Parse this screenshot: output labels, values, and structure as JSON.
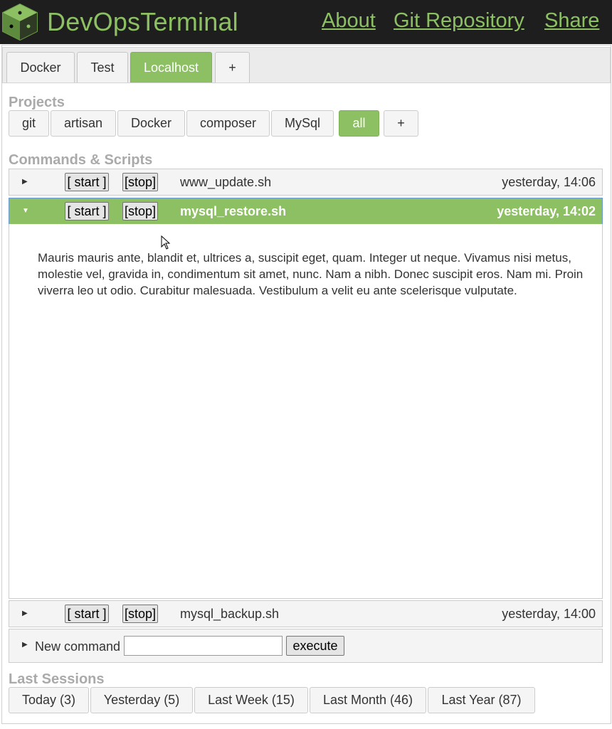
{
  "header": {
    "brand": "DevOpsTerminal",
    "links": [
      "About",
      "Git Repository",
      "Share"
    ],
    "brand_color": "#8cc063"
  },
  "env_tabs": [
    "Docker",
    "Test",
    "Localhost",
    "+"
  ],
  "active_env_tab": "Localhost",
  "projects": {
    "title": "Projects",
    "items": [
      "git",
      "artisan",
      "Docker",
      "composer",
      "MySql",
      "all",
      "+"
    ],
    "active": "all"
  },
  "commands": {
    "title": "Commands & Scripts",
    "rows": [
      {
        "start": "[ start ]",
        "stop": "[stop]",
        "name": "www_update.sh",
        "time": "yesterday, 14:06",
        "expanded": false
      },
      {
        "start": "[ start ]",
        "stop": "[stop]",
        "name": "mysql_restore.sh",
        "time": "yesterday, 14:02",
        "expanded": true
      },
      {
        "start": "[ start ]",
        "stop": "[stop]",
        "name": "mysql_backup.sh",
        "time": "yesterday, 14:00",
        "expanded": false
      }
    ],
    "expanded_text": "Mauris mauris ante, blandit et, ultrices a, suscipit eget, quam. Integer ut neque. Vivamus nisi metus, molestie vel, gravida in, condimentum sit amet, nunc. Nam a nibh. Donec suscipit eros. Nam mi. Proin viverra leo ut odio. Curabitur malesuada. Vestibulum a velit eu ante scelerisque vulputate.",
    "new_command_label": "New command",
    "new_command_value": "",
    "execute_label": "execute"
  },
  "sessions": {
    "title": "Last Sessions",
    "items": [
      "Today (3)",
      "Yesterday (5)",
      "Last Week (15)",
      "Last Month (46)",
      "Last Year (87)"
    ]
  },
  "colors": {
    "accent": "#8cc063",
    "header_bg": "#1e1e1e",
    "section_title": "#aaaaaa"
  }
}
